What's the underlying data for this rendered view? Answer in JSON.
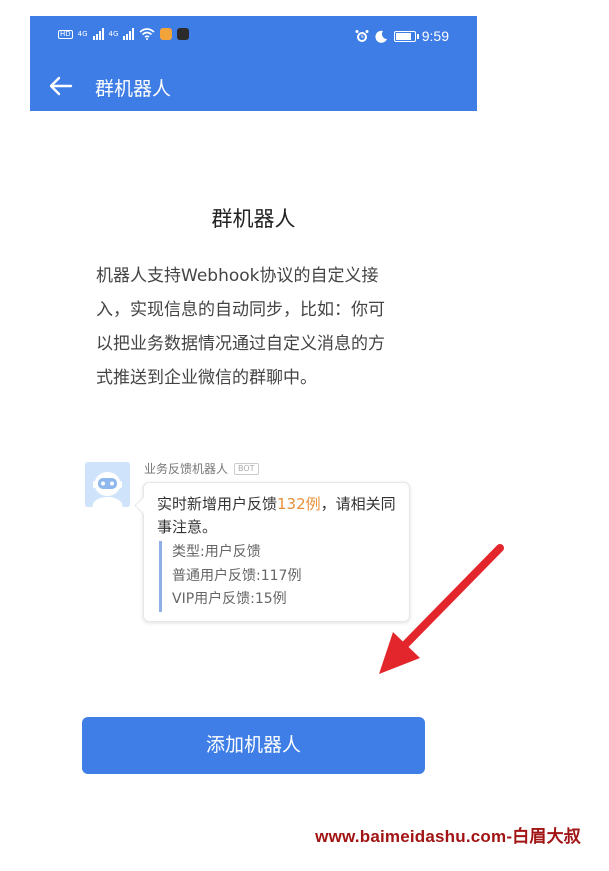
{
  "status_bar": {
    "time": "9:59",
    "network_1": "4G",
    "network_2": "4G",
    "icons": [
      "hd-icon",
      "signal-icon",
      "signal-icon",
      "wifi-icon",
      "app-notification-icon",
      "app-notification-icon",
      "alarm-icon",
      "moon-icon",
      "battery-icon"
    ]
  },
  "nav": {
    "title": "群机器人",
    "back_icon": "arrow-left-icon"
  },
  "main": {
    "title": "群机器人",
    "description_lines": [
      "机器人支持Webhook协议的自定义接",
      "入，实现信息的自动同步，比如：你可",
      "以把业务数据情况通过自定义消息的方",
      "式推送到企业微信的群聊中。"
    ]
  },
  "example": {
    "bot_name": "业务反馈机器人",
    "badge": "BOT",
    "message_prefix": "实时新增用户反馈",
    "message_highlight": "132例",
    "message_suffix": "，请相关同事注意。",
    "details": [
      "类型:用户反馈",
      "普通用户反馈:117例",
      "VIP用户反馈:15例"
    ],
    "highlight_color": "#e8913a"
  },
  "button": {
    "label": "添加机器人"
  },
  "watermark": "www.baimeidashu.com-白眉大叔",
  "colors": {
    "brand": "#3d7de5",
    "arrow": "#e3262c"
  }
}
